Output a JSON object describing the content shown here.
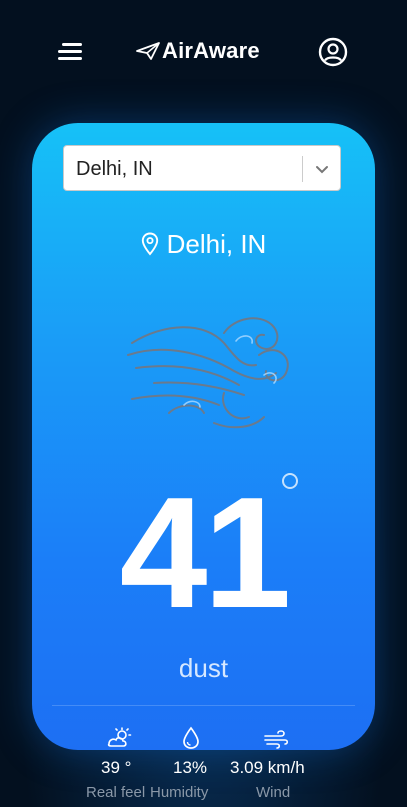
{
  "header": {
    "brand": "AirAware",
    "menu_icon": "menu-icon",
    "logo_icon": "paper-plane-icon",
    "account_icon": "user-circle-icon"
  },
  "location_select": {
    "value": "Delhi, IN",
    "chevron_icon": "chevron-down-icon"
  },
  "current": {
    "location": "Delhi, IN",
    "location_icon": "map-pin-icon",
    "weather_icon": "wind-dust-icon",
    "temperature": "41",
    "condition": "dust"
  },
  "stats": [
    {
      "icon": "sun-cloud-icon",
      "value": "39 °",
      "label": "Real feel"
    },
    {
      "icon": "droplet-icon",
      "value": "13%",
      "label": "Humidity"
    },
    {
      "icon": "wind-icon",
      "value": "3.09 km/h",
      "label": "Wind"
    }
  ],
  "colors": {
    "background": "#03101f",
    "card_top": "#16c1f7",
    "card_bottom": "#1d6ff3"
  }
}
